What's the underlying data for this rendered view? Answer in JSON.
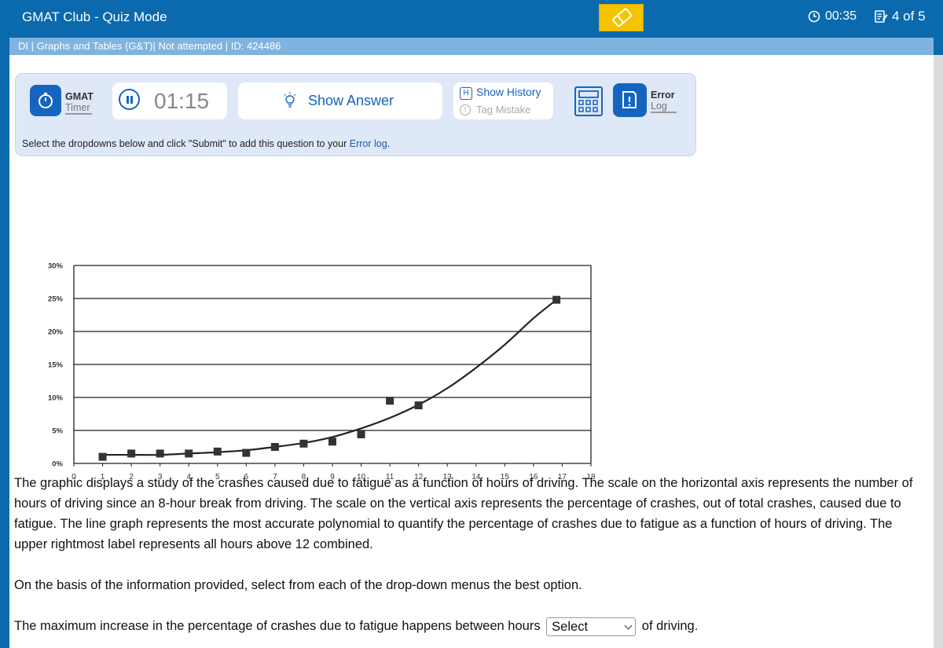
{
  "app": {
    "title": "GMAT Club - Quiz Mode",
    "elapsed_time": "00:35",
    "progress": "4 of 5",
    "accent_color": "#0a6aad",
    "eraser_color": "#f5c400"
  },
  "breadcrumb": "DI | Graphs and Tables (G&T)| Not attempted | ID: 424486",
  "toolbar": {
    "timer_title": "GMAT",
    "timer_sub": "Timer",
    "clock_value": "01:15",
    "show_answer": "Show Answer",
    "show_history": "Show History",
    "history_key": "H",
    "tag_mistake": "Tag Mistake",
    "error_title": "Error",
    "error_sub": "Log",
    "instruction_prefix": "Select the dropdowns below and click \"Submit\" to add this question to your ",
    "instruction_link": "Error log",
    "instruction_suffix": "."
  },
  "chart_data": {
    "type": "scatter",
    "title": "",
    "xlabel": "",
    "ylabel": "",
    "xlim": [
      0,
      18
    ],
    "ylim": [
      0,
      30
    ],
    "x_ticks": [
      "0",
      "1",
      "2",
      "3",
      "4",
      "5",
      "6",
      "7",
      "8",
      "9",
      "10",
      "11",
      "12",
      "13",
      "14",
      "15",
      "16",
      "17",
      "18"
    ],
    "y_ticks": [
      "0%",
      "5%",
      "10%",
      "15%",
      "20%",
      "25%",
      "30%"
    ],
    "grid": "horizontal",
    "points": [
      {
        "x": 1,
        "y": 1.0
      },
      {
        "x": 2,
        "y": 1.5
      },
      {
        "x": 3,
        "y": 1.5
      },
      {
        "x": 4,
        "y": 1.5
      },
      {
        "x": 5,
        "y": 1.8
      },
      {
        "x": 6,
        "y": 1.6
      },
      {
        "x": 7,
        "y": 2.5
      },
      {
        "x": 8,
        "y": 3.0
      },
      {
        "x": 9,
        "y": 3.3
      },
      {
        "x": 10,
        "y": 4.4
      },
      {
        "x": 11,
        "y": 9.5
      },
      {
        "x": 12,
        "y": 8.8
      },
      {
        "x": 16.8,
        "y": 24.8
      }
    ],
    "trend_line": [
      {
        "x": 1,
        "y": 1.3
      },
      {
        "x": 2,
        "y": 1.3
      },
      {
        "x": 3,
        "y": 1.3
      },
      {
        "x": 4,
        "y": 1.5
      },
      {
        "x": 5,
        "y": 1.7
      },
      {
        "x": 6,
        "y": 2.0
      },
      {
        "x": 7,
        "y": 2.5
      },
      {
        "x": 8,
        "y": 3.1
      },
      {
        "x": 9,
        "y": 4.0
      },
      {
        "x": 10,
        "y": 5.3
      },
      {
        "x": 11,
        "y": 6.9
      },
      {
        "x": 12,
        "y": 8.9
      },
      {
        "x": 13,
        "y": 11.4
      },
      {
        "x": 14,
        "y": 14.5
      },
      {
        "x": 15,
        "y": 18.0
      },
      {
        "x": 16,
        "y": 22.0
      },
      {
        "x": 16.8,
        "y": 24.8
      }
    ],
    "marker_color": "#333333",
    "line_color": "#222222"
  },
  "question": {
    "paragraph1": "The graphic displays a study of the crashes caused due to fatigue as a function of hours of driving. The scale on the horizontal axis represents the number of hours of driving since an 8-hour break from driving. The scale on the vertical axis represents the percentage of crashes, out of total crashes, caused due to fatigue. The line graph represents the most accurate polynomial to quantify the percentage of crashes due to fatigue as a function of hours of driving. The upper rightmost label represents all hours above 12 combined.",
    "paragraph2": "On the basis of the information provided, select from each of the drop-down menus the best option.",
    "statement_prefix": "The maximum increase in the percentage of crashes due to fatigue happens between hours",
    "dropdown_value": "Select",
    "statement_suffix": "of driving."
  }
}
